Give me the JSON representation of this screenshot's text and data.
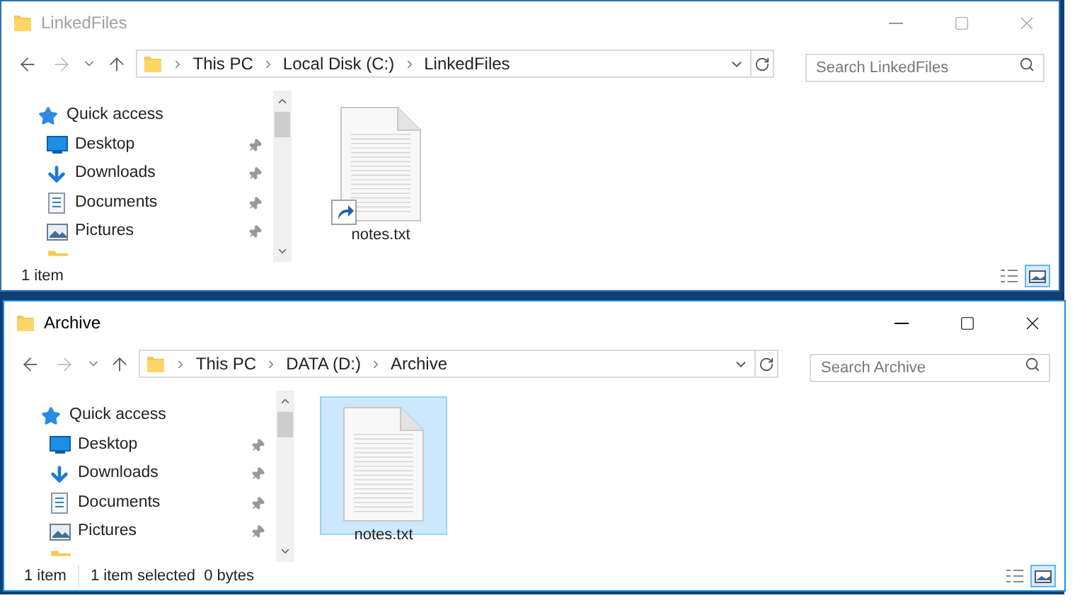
{
  "windows": [
    {
      "title": "LinkedFiles",
      "active": false,
      "breadcrumbs": [
        "This PC",
        "Local Disk (C:)",
        "LinkedFiles"
      ],
      "search": {
        "placeholder": "Search LinkedFiles"
      },
      "nav_items": [
        {
          "kind": "quick-access",
          "label": "Quick access",
          "pinned": false
        },
        {
          "kind": "desktop",
          "label": "Desktop",
          "pinned": true
        },
        {
          "kind": "downloads",
          "label": "Downloads",
          "pinned": true
        },
        {
          "kind": "documents",
          "label": "Documents",
          "pinned": true
        },
        {
          "kind": "pictures",
          "label": "Pictures",
          "pinned": true
        }
      ],
      "files": [
        {
          "name": "notes.txt",
          "selected": false,
          "shortcut": true
        }
      ],
      "status": [
        "1 item"
      ]
    },
    {
      "title": "Archive",
      "active": true,
      "breadcrumbs": [
        "This PC",
        "DATA (D:)",
        "Archive"
      ],
      "search": {
        "placeholder": "Search Archive"
      },
      "nav_items": [
        {
          "kind": "quick-access",
          "label": "Quick access",
          "pinned": false
        },
        {
          "kind": "desktop",
          "label": "Desktop",
          "pinned": true
        },
        {
          "kind": "downloads",
          "label": "Downloads",
          "pinned": true
        },
        {
          "kind": "documents",
          "label": "Documents",
          "pinned": true
        },
        {
          "kind": "pictures",
          "label": "Pictures",
          "pinned": true
        }
      ],
      "files": [
        {
          "name": "notes.txt",
          "selected": true,
          "shortcut": false
        }
      ],
      "status": [
        "1 item",
        "1 item selected  0 bytes"
      ]
    }
  ]
}
